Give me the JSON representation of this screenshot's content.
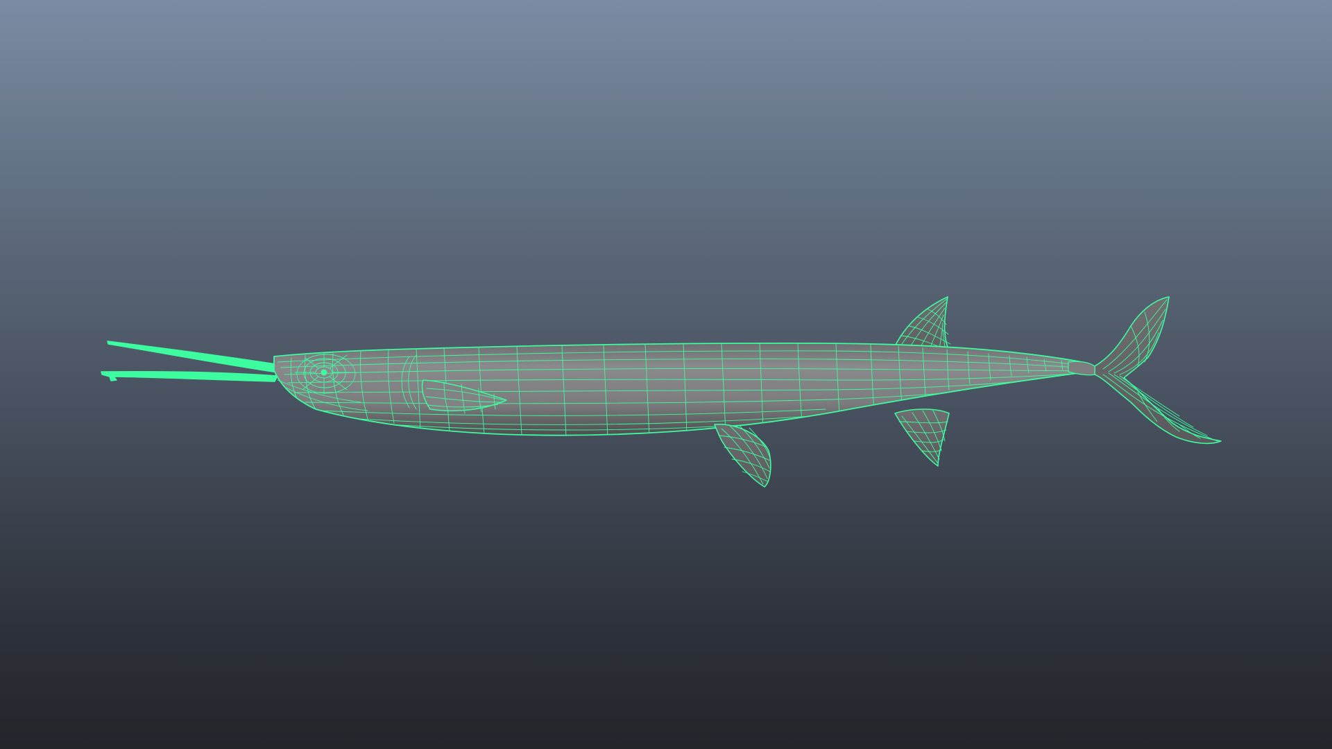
{
  "viewport": {
    "background_top": "#7a8ba3",
    "background_bottom": "#22252a"
  },
  "model": {
    "subject": "fish-wireframe-mesh",
    "display_mode": "wireframe-on-shaded",
    "wire_color": "#3dfca0",
    "shaded_color": "#7f7f80",
    "shade_dark": "#5c5c5e",
    "selected": true
  }
}
